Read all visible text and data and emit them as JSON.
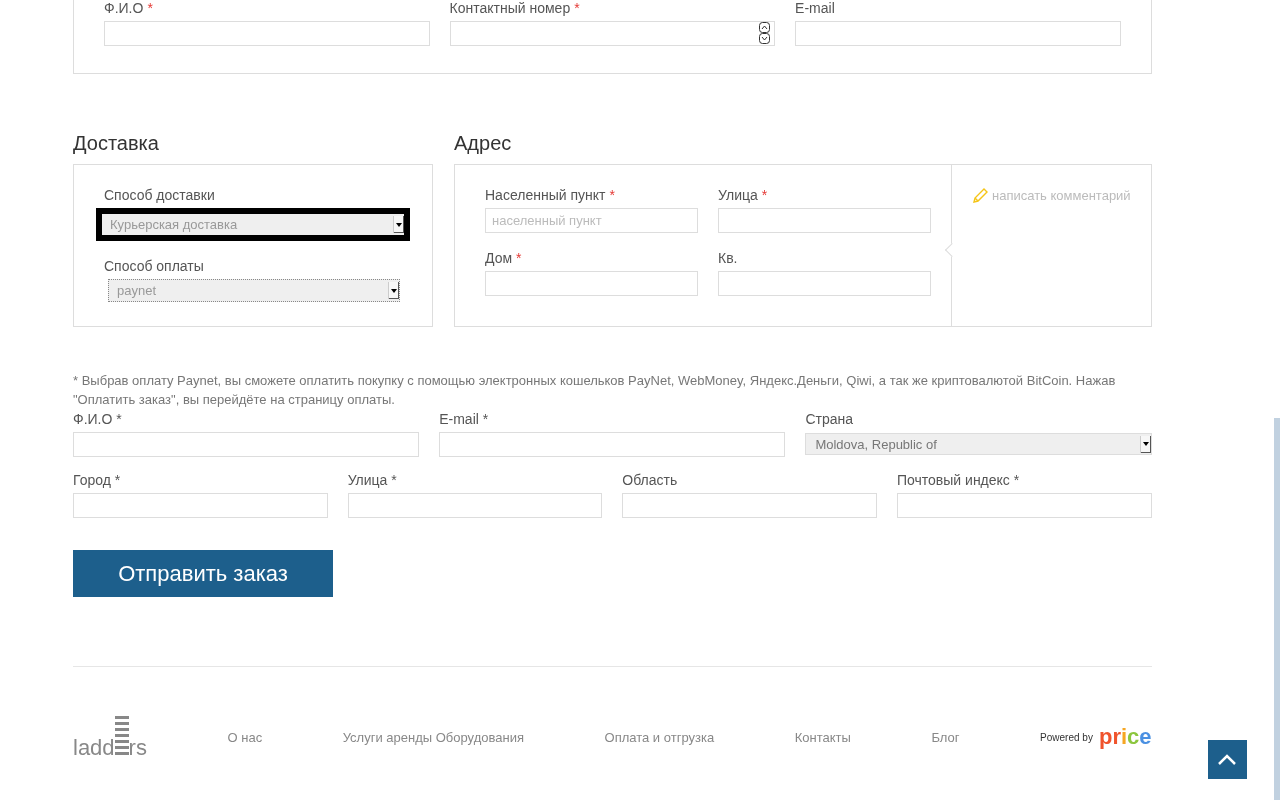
{
  "contact": {
    "fields": [
      {
        "label": "Ф.И.О",
        "mark": "*",
        "kind": "text"
      },
      {
        "label": "Контактный номер",
        "mark": "*",
        "kind": "number"
      },
      {
        "label": "E-mail",
        "kind": "text"
      }
    ]
  },
  "delivery": {
    "title": "Доставка",
    "fields": [
      {
        "label": "Способ доставки",
        "value": "Курьерская доставка",
        "focused": true
      },
      {
        "label": "Способ оплаты",
        "value": "paynet",
        "focused": false
      }
    ]
  },
  "address": {
    "title": "Адрес",
    "fields": [
      {
        "label": "Населенный пункт",
        "mark": "*",
        "placeholder": "населенный пункт"
      },
      {
        "label": "Улица",
        "mark": "*"
      },
      {
        "label": "Дом",
        "mark": "*"
      },
      {
        "label": "Кв."
      }
    ],
    "comment_link": "написать комментарий"
  },
  "note": "* Выбрав оплату Paynet, вы сможете оплатить покупку с помощью электронных кошельков PayNet, WebMoney, Яндекс.Деньги, Qiwi, а так же криптовалютой BitCoin. Нажав \"Оплатить заказ\", вы перейдёте на страницу оплаты.",
  "billing": {
    "rows": [
      [
        {
          "label": "Ф.И.О *",
          "kind": "text"
        },
        {
          "label": "E-mail *",
          "kind": "text"
        },
        {
          "label": "Страна",
          "kind": "select",
          "value": "Moldova, Republic of"
        }
      ],
      [
        {
          "label": "Город *",
          "kind": "text"
        },
        {
          "label": "Улица *",
          "kind": "text"
        },
        {
          "label": "Область",
          "kind": "text"
        },
        {
          "label": "Почтовый индекс *",
          "kind": "text"
        }
      ]
    ]
  },
  "submit_button": "Отправить заказ",
  "footer": {
    "logo": {
      "left": "ladd",
      "right": "rs"
    },
    "links": [
      "О нас",
      "Услуги аренды Оборудования",
      "Оплата и отгрузка",
      "Контакты",
      "Блог"
    ],
    "powered_by": "Powered by",
    "brand_letters": [
      {
        "text": "p",
        "color": "#f0542d"
      },
      {
        "text": "r",
        "color": "#f0542d"
      },
      {
        "text": "i",
        "color": "#f5a623"
      },
      {
        "text": "c",
        "color": "#8cc63f"
      },
      {
        "text": "e",
        "color": "#4a90e2"
      }
    ]
  }
}
